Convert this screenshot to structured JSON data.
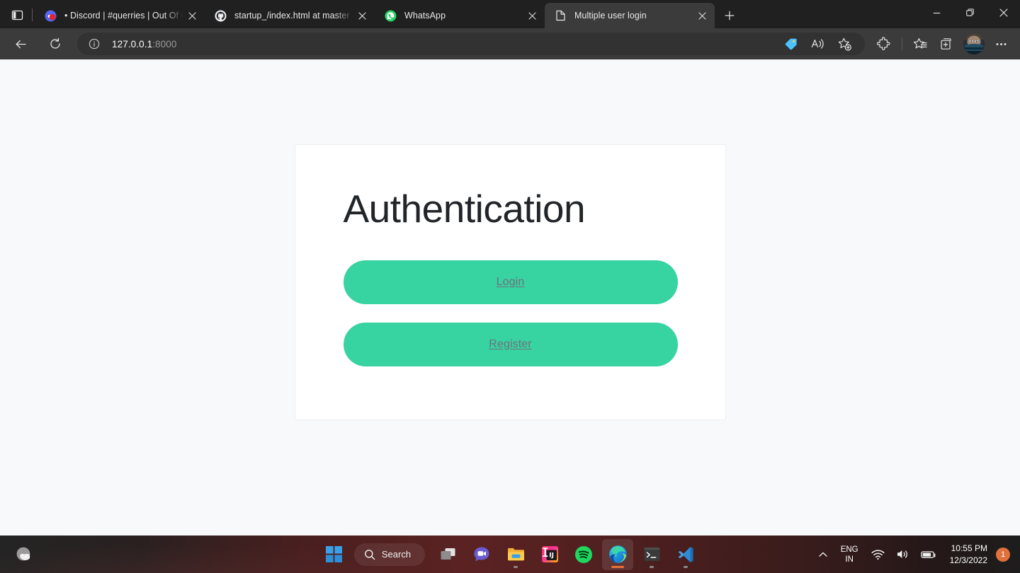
{
  "browser": {
    "tab_actions_tooltip": "Tab actions menu",
    "tabs": [
      {
        "title": "• Discord | #querries | Out Of Co",
        "favicon": "discord-icon",
        "active": false
      },
      {
        "title": "startup_/index.html at master · D",
        "favicon": "github-icon",
        "active": false
      },
      {
        "title": "WhatsApp",
        "favicon": "whatsapp-icon",
        "active": false
      },
      {
        "title": "Multiple user login",
        "favicon": "page-document-icon",
        "active": true
      }
    ],
    "new_tab_label": "+",
    "window_controls": {
      "minimize": "minimize-icon",
      "maximize": "restore-icon",
      "close": "close-icon"
    },
    "toolbar": {
      "back": "back-arrow-icon",
      "refresh": "refresh-icon",
      "site_info": "info-icon",
      "url_host": "127.0.0.1",
      "url_port": ":8000",
      "url_full": "127.0.0.1:8000",
      "actions": [
        {
          "name": "shopping-tag-icon",
          "label": "Shopping"
        },
        {
          "name": "read-aloud-icon",
          "label": "Read aloud"
        },
        {
          "name": "add-favorite-star-icon",
          "label": "Add this page to favorites"
        },
        {
          "name": "extensions-puzzle-icon",
          "label": "Extensions"
        },
        {
          "name": "favorites-list-icon",
          "label": "Favorites"
        },
        {
          "name": "collections-icon",
          "label": "Collections"
        }
      ],
      "profile": "avatar-icon",
      "settings_more": "ellipsis-icon"
    }
  },
  "page": {
    "title": "Authentication",
    "buttons": [
      {
        "label": "Login",
        "name": "login-link"
      },
      {
        "label": "Register",
        "name": "register-link"
      }
    ],
    "colors": {
      "page_background": "#f8f9fa",
      "card_background": "#ffffff",
      "button_green": "#37d3a0",
      "link_text": "#70707f",
      "heading_text": "#212529"
    }
  },
  "taskbar": {
    "weather": "weather-widget-icon",
    "start": "windows-start-icon",
    "search_label": "Search",
    "search_icon": "search-icon",
    "items": [
      {
        "name": "task-view-icon",
        "label": "Task View",
        "running": false,
        "active": false
      },
      {
        "name": "chat-teams-icon",
        "label": "Chat",
        "running": false,
        "active": false
      },
      {
        "name": "file-explorer-icon",
        "label": "File Explorer",
        "running": true,
        "active": false
      },
      {
        "name": "intellij-idea-icon",
        "label": "IntelliJ IDEA",
        "running": false,
        "active": false
      },
      {
        "name": "spotify-icon",
        "label": "Spotify",
        "running": false,
        "active": false
      },
      {
        "name": "microsoft-edge-icon",
        "label": "Microsoft Edge",
        "running": true,
        "active": true
      },
      {
        "name": "terminal-icon",
        "label": "Windows Terminal",
        "running": true,
        "active": false
      },
      {
        "name": "vscode-icon",
        "label": "Visual Studio Code",
        "running": true,
        "active": false
      }
    ],
    "tray": {
      "chevron": "chevron-up-icon",
      "language_primary": "ENG",
      "language_secondary": "IN",
      "wifi": "wifi-icon",
      "volume": "volume-icon",
      "battery": "battery-icon",
      "time": "10:55 PM",
      "date": "12/3/2022",
      "notification_count": "1"
    },
    "colors": {
      "accent": "#e8703a",
      "tint": "#4e1f1f"
    }
  }
}
